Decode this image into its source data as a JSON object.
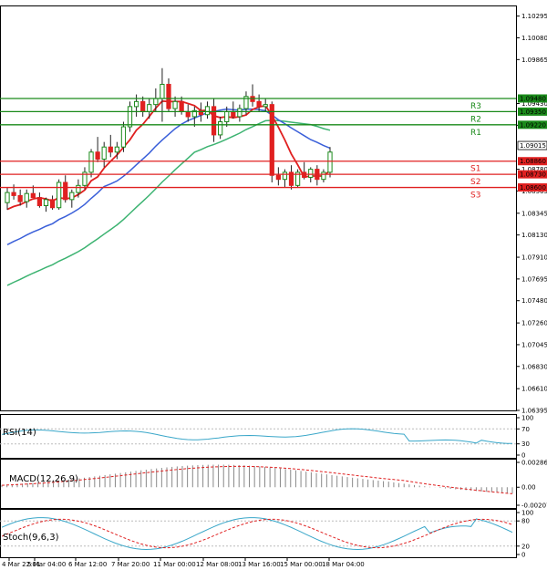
{
  "chart_data": {
    "type": "candlestick",
    "price_axis": {
      "ticks": [
        "1.10295",
        "1.10080",
        "1.09865",
        "1.09430",
        "1.09215",
        "1.08780",
        "1.08565",
        "1.08345",
        "1.08130",
        "1.07910",
        "1.07695",
        "1.07480",
        "1.07260",
        "1.07045",
        "1.06830",
        "1.06610",
        "1.06395"
      ],
      "range": [
        1.06395,
        1.104
      ]
    },
    "time_axis": {
      "labels": [
        "4 Mar 22:01",
        "5 Mar 04:00",
        "6 Mar 12:00",
        "7 Mar 20:00",
        "11 Mar 00:00",
        "12 Mar 08:00",
        "13 Mar 16:00",
        "15 Mar 00:00",
        "18 Mar 04:00"
      ]
    },
    "current_price": "1.09015",
    "levels": [
      {
        "name": "R3",
        "price": 1.0948,
        "tag": "1.09480",
        "color": "#1a8a1a"
      },
      {
        "name": "R2",
        "price": 1.0935,
        "tag": "1.09350",
        "color": "#1a8a1a"
      },
      {
        "name": "R1",
        "price": 1.0922,
        "tag": "1.09220",
        "color": "#1a8a1a"
      },
      {
        "name": "S1",
        "price": 1.0886,
        "tag": "1.08860",
        "color": "#e02020"
      },
      {
        "name": "S2",
        "price": 1.0873,
        "tag": "1.08730",
        "color": "#e02020"
      },
      {
        "name": "S3",
        "price": 1.086,
        "tag": "1.08600",
        "color": "#e02020"
      }
    ],
    "candles": [
      [
        1.0845,
        1.086,
        1.0838,
        1.0855
      ],
      [
        1.0855,
        1.0863,
        1.0848,
        1.0852
      ],
      [
        1.0852,
        1.0858,
        1.0842,
        1.0846
      ],
      [
        1.0846,
        1.0858,
        1.084,
        1.0854
      ],
      [
        1.0854,
        1.0862,
        1.085,
        1.085
      ],
      [
        1.085,
        1.0855,
        1.084,
        1.0842
      ],
      [
        1.0842,
        1.085,
        1.0836,
        1.0848
      ],
      [
        1.0848,
        1.0852,
        1.0838,
        1.084
      ],
      [
        1.084,
        1.0868,
        1.0838,
        1.0865
      ],
      [
        1.0865,
        1.0872,
        1.0845,
        1.0848
      ],
      [
        1.0848,
        1.0858,
        1.084,
        1.0855
      ],
      [
        1.0855,
        1.0868,
        1.085,
        1.0862
      ],
      [
        1.0862,
        1.088,
        1.0858,
        1.0875
      ],
      [
        1.0875,
        1.0898,
        1.087,
        1.0895
      ],
      [
        1.0895,
        1.091,
        1.0885,
        1.0888
      ],
      [
        1.0888,
        1.0905,
        1.088,
        1.09
      ],
      [
        1.09,
        1.0912,
        1.089,
        1.0895
      ],
      [
        1.0895,
        1.0905,
        1.0888,
        1.09
      ],
      [
        1.09,
        1.0925,
        1.0895,
        1.092
      ],
      [
        1.092,
        1.0945,
        1.0915,
        1.094
      ],
      [
        1.094,
        1.0952,
        1.093,
        1.0945
      ],
      [
        1.0945,
        1.095,
        1.093,
        1.0935
      ],
      [
        1.0935,
        1.0948,
        1.0928,
        1.0942
      ],
      [
        1.0942,
        1.0958,
        1.0935,
        1.0948
      ],
      [
        1.0948,
        1.0978,
        1.0925,
        1.0962
      ],
      [
        1.0962,
        1.0968,
        1.0935,
        1.0938
      ],
      [
        1.0938,
        1.095,
        1.093,
        1.0945
      ],
      [
        1.0945,
        1.095,
        1.0932,
        1.0935
      ],
      [
        1.0935,
        1.0942,
        1.0925,
        1.093
      ],
      [
        1.093,
        1.094,
        1.092,
        1.0936
      ],
      [
        1.0936,
        1.0944,
        1.0925,
        1.0932
      ],
      [
        1.0932,
        1.0945,
        1.0928,
        1.094
      ],
      [
        1.094,
        1.0948,
        1.0905,
        1.0912
      ],
      [
        1.0912,
        1.093,
        1.0908,
        1.0925
      ],
      [
        1.0925,
        1.094,
        1.092,
        1.0935
      ],
      [
        1.0935,
        1.0945,
        1.0928,
        1.093
      ],
      [
        1.093,
        1.0942,
        1.0925,
        1.0938
      ],
      [
        1.0938,
        1.0955,
        1.0932,
        1.095
      ],
      [
        1.095,
        1.0962,
        1.094,
        1.0945
      ],
      [
        1.0945,
        1.0952,
        1.0935,
        1.094
      ],
      [
        1.094,
        1.0948,
        1.0935,
        1.0942
      ],
      [
        1.0942,
        1.0945,
        1.0865,
        1.0872
      ],
      [
        1.0872,
        1.088,
        1.0862,
        1.0868
      ],
      [
        1.0868,
        1.0878,
        1.086,
        1.0875
      ],
      [
        1.0875,
        1.0882,
        1.0858,
        1.0862
      ],
      [
        1.0862,
        1.0878,
        1.086,
        1.0875
      ],
      [
        1.0875,
        1.0885,
        1.0868,
        1.087
      ],
      [
        1.087,
        1.088,
        1.0865,
        1.0878
      ],
      [
        1.0878,
        1.0882,
        1.0862,
        1.0868
      ],
      [
        1.0868,
        1.0878,
        1.0865,
        1.0875
      ],
      [
        1.0875,
        1.09,
        1.087,
        1.0895
      ]
    ],
    "indicators": [
      {
        "name": "RSI(14)",
        "ticks": [
          "100",
          "70",
          "30",
          "0"
        ],
        "range": [
          0,
          100
        ]
      },
      {
        "name": "MACD(12,26,9)",
        "ticks": [
          "0.002864",
          "0.00",
          "-0.002077"
        ],
        "range": [
          -0.002077,
          0.002864
        ]
      },
      {
        "name": "Stoch(9,6,3)",
        "ticks": [
          "100",
          "80",
          "20",
          "0"
        ],
        "range": [
          0,
          100
        ]
      }
    ],
    "colors": {
      "up": "#1a8a1a",
      "down": "#e02020",
      "ma_fast": "#e02020",
      "ma_mid": "#3a5fd9",
      "ma_slow": "#3cb371",
      "signal": "#e02020",
      "rsi": "#3aa7c9",
      "stoch_main": "#3aa7c9"
    }
  }
}
